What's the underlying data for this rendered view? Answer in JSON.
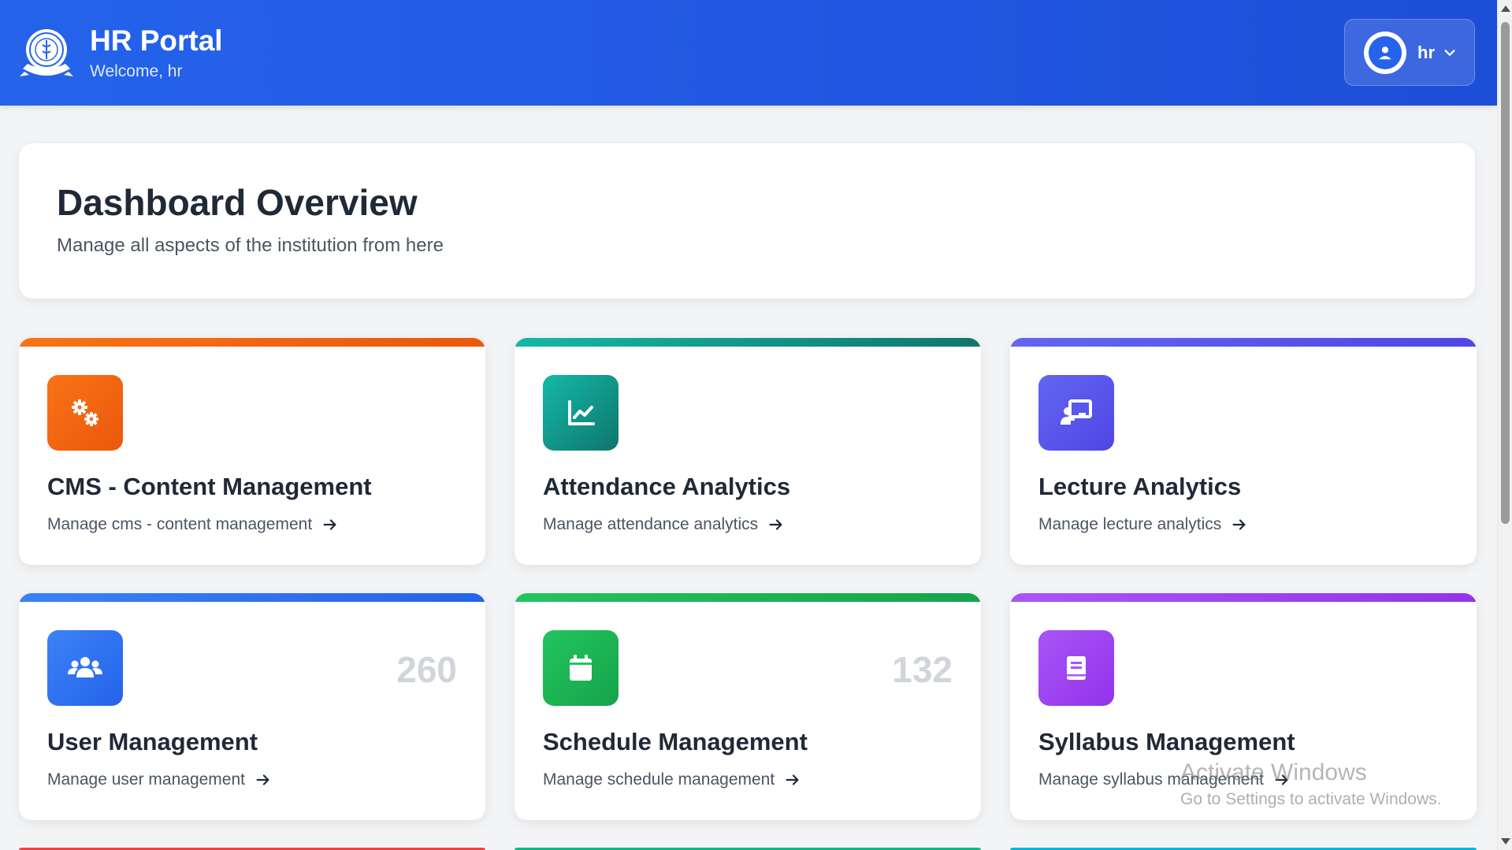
{
  "header": {
    "title": "HR Portal",
    "welcome": "Welcome, hr",
    "logo_icon": "institution-seal-logo",
    "user_name": "hr",
    "avatar_icon": "user-circle-icon",
    "dropdown_icon": "chevron-down-icon"
  },
  "overview": {
    "title": "Dashboard Overview",
    "subtitle": "Manage all aspects of the institution from here"
  },
  "cards": [
    {
      "title": "CMS - Content Management",
      "link": "Manage cms - content management",
      "count": "",
      "icon": "cogs-icon",
      "color": "#f97316"
    },
    {
      "title": "Attendance Analytics",
      "link": "Manage attendance analytics",
      "count": "",
      "icon": "chart-line-icon",
      "color": "#14b8a6"
    },
    {
      "title": "Lecture Analytics",
      "link": "Manage lecture analytics",
      "count": "",
      "icon": "chalkboard-teacher-icon",
      "color": "#6366f1"
    },
    {
      "title": "User Management",
      "link": "Manage user management",
      "count": "260",
      "icon": "users-icon",
      "color": "#3b82f6"
    },
    {
      "title": "Schedule Management",
      "link": "Manage schedule management",
      "count": "132",
      "icon": "calendar-icon",
      "color": "#22c55e"
    },
    {
      "title": "Syllabus Management",
      "link": "Manage syllabus management",
      "count": "",
      "icon": "book-icon",
      "color": "#a855f7"
    }
  ],
  "partial_cards_colors": [
    "#ef4444",
    "#10b981",
    "#06b6d4"
  ],
  "watermark": {
    "line1": "Activate Windows",
    "line2": "Go to Settings to activate Windows."
  }
}
